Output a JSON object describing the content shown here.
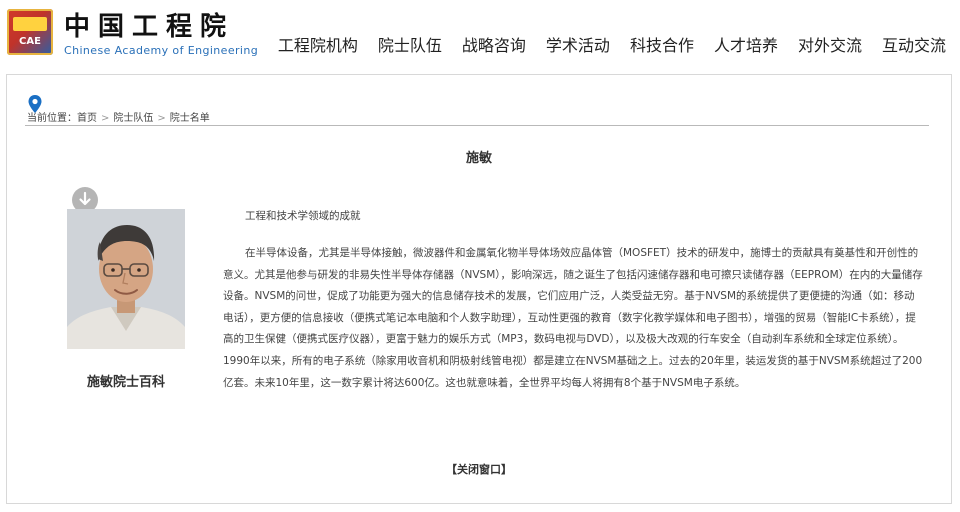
{
  "logo": {
    "badge_text": "CAE",
    "cn_name": "中国工程院",
    "en_name": "Chinese Academy of Engineering"
  },
  "nav": {
    "items": [
      {
        "label": "工程院机构"
      },
      {
        "label": "院士队伍"
      },
      {
        "label": "战略咨询"
      },
      {
        "label": "学术活动"
      },
      {
        "label": "科技合作"
      },
      {
        "label": "人才培养"
      },
      {
        "label": "对外交流"
      },
      {
        "label": "互动交流"
      }
    ]
  },
  "breadcrumb": {
    "prefix": "当前位置：",
    "items": [
      {
        "label": "首页"
      },
      {
        "label": "院士队伍"
      },
      {
        "label": "院士名单"
      }
    ],
    "separator": ">"
  },
  "profile": {
    "name": "施敏",
    "caption": "施敏院士百科",
    "lead": "工程和技术学领域的成就",
    "body": "在半导体设备，尤其是半导体接触，微波器件和金属氧化物半导体场效应晶体管（MOSFET）技术的研发中，施博士的贡献具有奠基性和开创性的意义。尤其是他参与研发的非易失性半导体存储器（NVSM），影响深远，随之诞生了包括闪速储存器和电可擦只读储存器（EEPROM）在内的大量储存设备。NVSM的问世，促成了功能更为强大的信息储存技术的发展，它们应用广泛，人类受益无穷。基于NVSM的系统提供了更便捷的沟通（如：移动电话），更方便的信息接收（便携式笔记本电脑和个人数字助理），互动性更强的教育（数字化教学媒体和电子图书），增强的贸易（智能IC卡系统），提高的卫生保健（便携式医疗仪器），更富于魅力的娱乐方式（MP3，数码电视与DVD），以及极大改观的行车安全（自动刹车系统和全球定位系统）。1990年以来，所有的电子系统（除家用收音机和阴极射线管电视）都是建立在NVSM基础之上。过去的20年里，装运发货的基于NVSM系统超过了200亿套。未来10年里，这一数字累计将达600亿。这也就意味着，全世界平均每人将拥有8个基于NVSM电子系统。"
  },
  "footer": {
    "close_label": "【关闭窗口】"
  },
  "colors": {
    "accent_blue": "#1a6fc4",
    "logo_red": "#c0332a",
    "logo_gold": "#ffd23f"
  }
}
